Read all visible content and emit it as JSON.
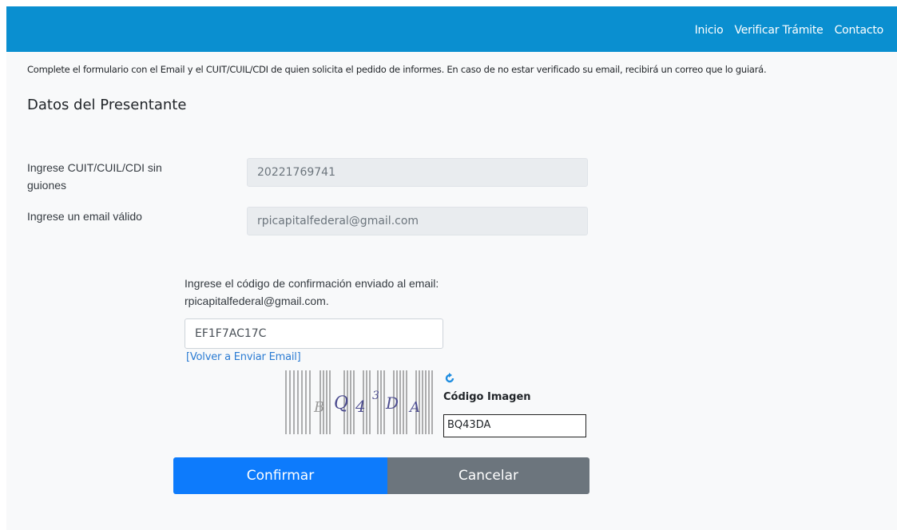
{
  "nav": {
    "links": [
      "Inicio",
      "Verificar Trámite",
      "Contacto"
    ],
    "background": "#0a8fd0"
  },
  "intro_text": "Complete el formulario con el Email y el CUIT/CUIL/CDI de quien solicita el pedido de informes. En caso de no estar verificado su email, recibirá un correo que lo guiará.",
  "section_title": "Datos del Presentante",
  "form": {
    "cuit_label": "Ingrese CUIT/CUIL/CDI sin guiones",
    "cuit_value": "20221769741",
    "email_label": "Ingrese un email válido",
    "email_value": "rpicapitalfederal@gmail.com",
    "confirmation_label": "Ingrese el código de confirmación enviado al email: rpicapitalfederal@gmail.com.",
    "confirmation_code": "EF1F7AC17C",
    "resend_link": "[Volver a Enviar Email]"
  },
  "captcha": {
    "characters": [
      "B",
      "Q",
      "4",
      "3",
      "D",
      "A"
    ],
    "label": "Código Imagen",
    "value": "BQ43DA",
    "refresh_icon": "refresh-icon"
  },
  "buttons": {
    "confirm": "Confirmar",
    "cancel": "Cancelar",
    "confirm_color": "#0d7bfc",
    "cancel_color": "#6c757d"
  }
}
